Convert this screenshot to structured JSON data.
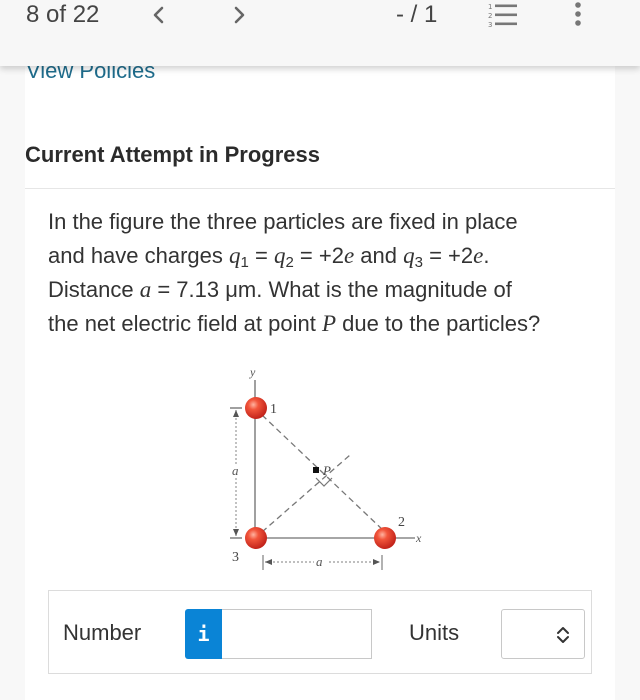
{
  "toolbar": {
    "question_counter": "8 of 22",
    "prev_icon": "chevron-left-icon",
    "next_icon": "chevron-right-icon",
    "score": "- / 1",
    "list_icon": "numbered-list-icon",
    "list_numbers": [
      "1",
      "2",
      "3"
    ],
    "more_icon": "more-vertical-icon"
  },
  "links": {
    "view_policies": "View Policies"
  },
  "section": {
    "title": "Current Attempt in Progress"
  },
  "question": {
    "line1": "In the figure the three particles are fixed in place",
    "line2_pre": "and have charges ",
    "q1": "q",
    "q1_sub": "1",
    "eq1": " = ",
    "q2": "q",
    "q2_sub": "2",
    "eq2": " = +2",
    "e1": "e",
    "and": " and ",
    "q3": "q",
    "q3_sub": "3",
    "eq3": " = +2",
    "e2": "e",
    "period": ".",
    "line3_pre": "Distance ",
    "a_var": "a",
    "line3_post": " = 7.13 μm. What is the magnitude of",
    "line4_pre": "the net electric field at point ",
    "p_var": "P",
    "line4_post": " due to the particles?"
  },
  "figure": {
    "y_axis_label": "y",
    "x_axis_label": "x",
    "particle_labels": [
      "1",
      "2",
      "3"
    ],
    "point_label": "P",
    "distance_label_vertical": "a",
    "distance_label_horizontal": "a",
    "particle_color": "#e8412f"
  },
  "answer": {
    "number_label": "Number",
    "info_icon_text": "i",
    "number_value": "",
    "units_label": "Units",
    "units_selected": "",
    "info_color": "#0a84d6"
  }
}
